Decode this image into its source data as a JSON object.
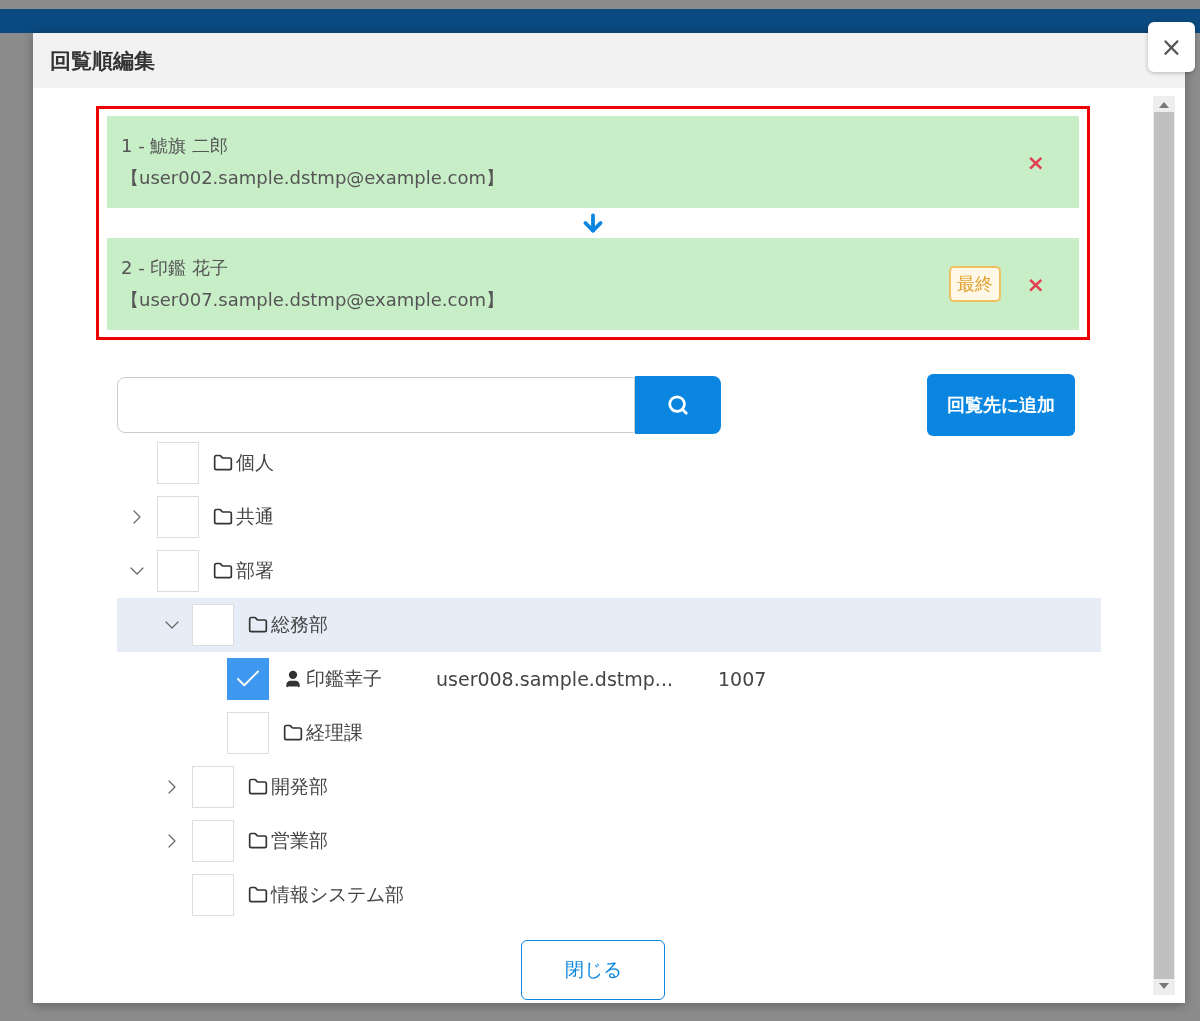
{
  "dialog": {
    "title": "回覧順編集",
    "close_label": "×"
  },
  "route": [
    {
      "name": "1 - 鯱旗 二郎",
      "email": "【user002.sample.dstmp@example.com】",
      "remove": "×"
    },
    {
      "name": "2 - 印鑑 花子",
      "email": "【user007.sample.dstmp@example.com】",
      "badge": "最終",
      "remove": "×"
    }
  ],
  "add_button": "回覧先に追加",
  "tree": [
    {
      "kind": "folder",
      "label": "個人",
      "checked": false,
      "selected": false
    },
    {
      "kind": "folder",
      "label": "共通",
      "checked": false,
      "selected": false,
      "expanded": false
    },
    {
      "kind": "folder",
      "label": "部署",
      "checked": false,
      "selected": false,
      "expanded": true,
      "children": [
        {
          "kind": "folder",
          "label": "総務部",
          "checked": false,
          "selected": true,
          "expanded": true,
          "children": [
            {
              "kind": "user",
              "label": "印鑑幸子",
              "email": "user008.sample.dstmp...",
              "code": "1007",
              "checked": true,
              "selected": false
            },
            {
              "kind": "folder",
              "label": "経理課",
              "checked": false,
              "selected": false
            }
          ]
        },
        {
          "kind": "folder",
          "label": "開発部",
          "checked": false,
          "selected": false,
          "expanded": false
        },
        {
          "kind": "folder",
          "label": "営業部",
          "checked": false,
          "selected": false,
          "expanded": false
        },
        {
          "kind": "folder",
          "label": "情報システム部",
          "checked": false,
          "selected": false
        }
      ]
    }
  ],
  "footer_button": "閉じる"
}
